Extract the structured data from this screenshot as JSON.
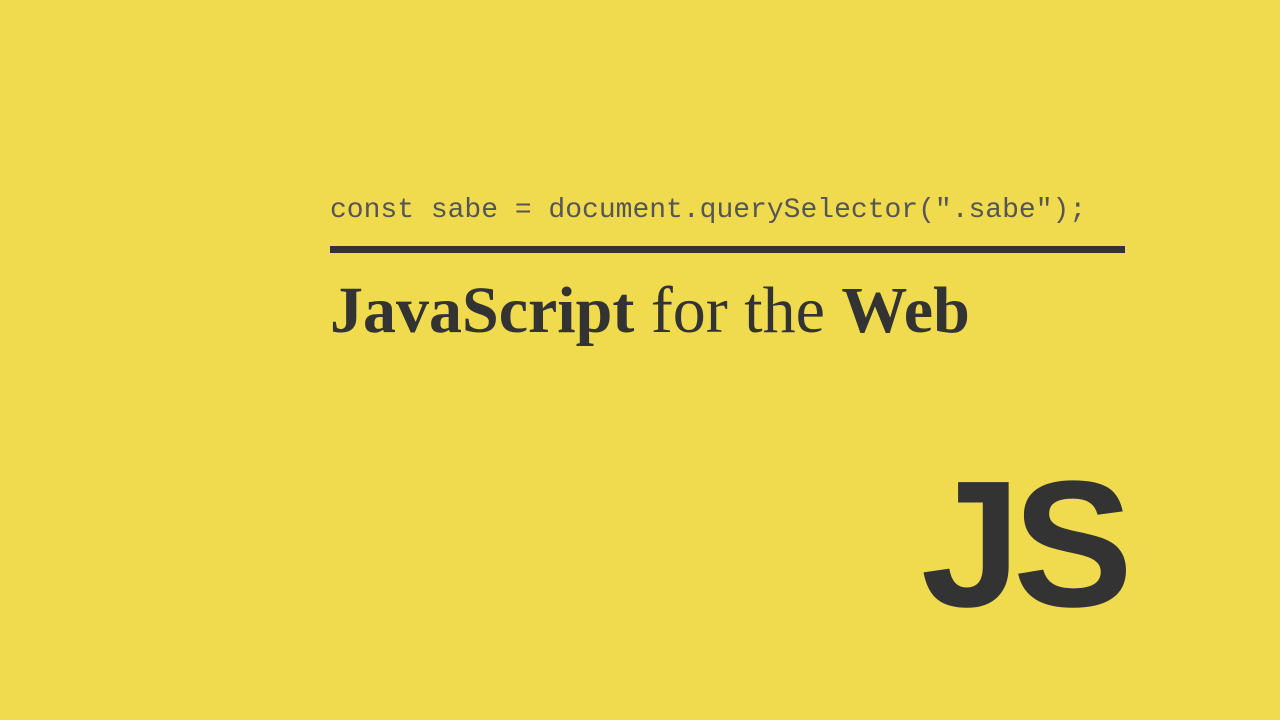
{
  "code": "const sabe = document.querySelector(\".sabe\");",
  "heading": {
    "word1": "JavaScript",
    "word2": "for the",
    "word3": "Web"
  },
  "logo": "JS",
  "colors": {
    "background": "#f0db4f",
    "text": "#333333",
    "codeText": "#555555"
  }
}
